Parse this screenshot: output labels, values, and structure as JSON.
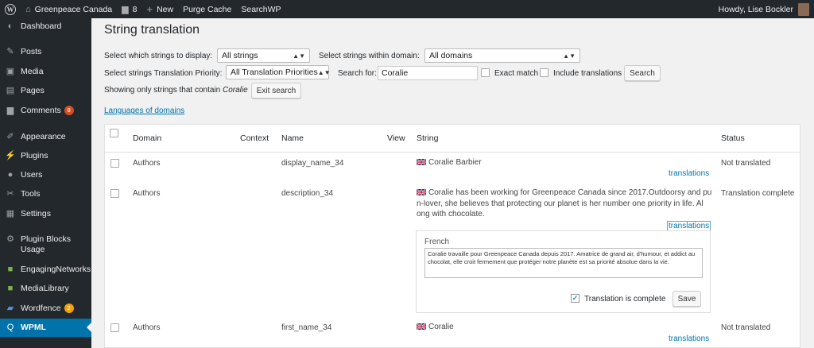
{
  "adminbar": {
    "site_name": "Greenpeace Canada",
    "comments_count": "8",
    "new_label": "New",
    "purge_cache": "Purge Cache",
    "searchwp": "SearchWP",
    "howdy": "Howdy, Lise Bockler"
  },
  "sidebar": {
    "items": [
      {
        "label": "Dashboard",
        "icon": "dashboard-icon"
      },
      {
        "label": "Posts",
        "icon": "pin-icon"
      },
      {
        "label": "Media",
        "icon": "media-icon"
      },
      {
        "label": "Pages",
        "icon": "pages-icon"
      },
      {
        "label": "Comments",
        "icon": "comments-icon",
        "badge": "8"
      },
      {
        "label": "Appearance",
        "icon": "brush-icon"
      },
      {
        "label": "Plugins",
        "icon": "plug-icon"
      },
      {
        "label": "Users",
        "icon": "users-icon"
      },
      {
        "label": "Tools",
        "icon": "wrench-icon"
      },
      {
        "label": "Settings",
        "icon": "settings-icon"
      },
      {
        "label": "Plugin Blocks Usage",
        "icon": "gear-icon"
      },
      {
        "label": "EngagingNetworks",
        "icon": "en-icon"
      },
      {
        "label": "MediaLibrary",
        "icon": "library-icon"
      },
      {
        "label": "Wordfence",
        "icon": "wordfence-icon",
        "badge": "2"
      },
      {
        "label": "WPML",
        "icon": "wpml-icon"
      }
    ]
  },
  "main": {
    "title": "String translation",
    "filters": {
      "display_label": "Select which strings to display:",
      "display_value": "All strings",
      "domain_label": "Select strings within domain:",
      "domain_value": "All domains",
      "priority_label": "Select strings Translation Priority:",
      "priority_value": "All Translation Priorities",
      "search_label": "Search for:",
      "search_value": "Coralie",
      "exact_match": "Exact match",
      "include_translations": "Include translations",
      "search_button": "Search",
      "showing_prefix": "Showing only strings that contain",
      "showing_term": "Coralie",
      "exit_search": "Exit search",
      "languages_link": "Languages of domains"
    },
    "table": {
      "headers": {
        "domain": "Domain",
        "context": "Context",
        "name": "Name",
        "view": "View",
        "string": "String",
        "status": "Status"
      },
      "rows": [
        {
          "domain": "Authors",
          "name": "display_name_34",
          "string": "Coralie Barbier",
          "translations": "translations",
          "status": "Not translated"
        },
        {
          "domain": "Authors",
          "name": "description_34",
          "string_lines": [
            "Coralie has been working for Greenpeace Canada since 2017.Outdoorsy and pu",
            "n-lover, she believes that protecting our planet is her number one priority in life. Al",
            "ong with chocolate."
          ],
          "translations": "translations",
          "status": "Translation complete"
        },
        {
          "domain": "Authors",
          "name": "first_name_34",
          "string": "Coralie",
          "translations": "translations",
          "status": "Not translated"
        }
      ],
      "translation_editor": {
        "language": "French",
        "text": "Coralie travaille pour Greenpeace Canada depuis 2017. Amatrice de grand air, d'humour, et addict au chocolat, elle croit fermement que protéger notre planète est sa priorité absolue dans la vie.",
        "complete_label": "Translation is complete",
        "save": "Save"
      }
    }
  }
}
